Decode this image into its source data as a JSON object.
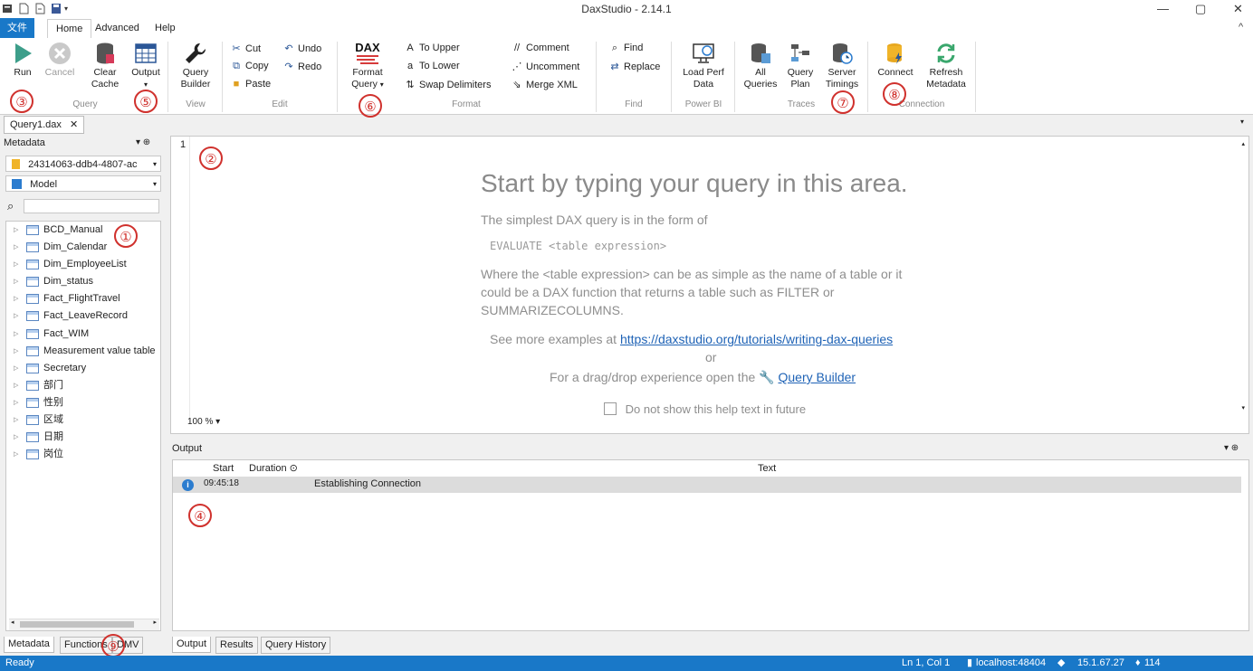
{
  "window": {
    "title": "DaxStudio - 2.14.1",
    "minimize_glyph": "—",
    "maximize_glyph": "▢",
    "close_glyph": "✕",
    "ribbon_collapse_glyph": "^"
  },
  "tabs": [
    {
      "label": "文件"
    },
    {
      "label": "Home"
    },
    {
      "label": "Advanced"
    },
    {
      "label": "Help"
    }
  ],
  "ribbon": {
    "query": {
      "run": "Run",
      "cancel": "Cancel",
      "clear_cache_1": "Clear",
      "clear_cache_2": "Cache",
      "output": "Output",
      "label": "Query"
    },
    "view": {
      "qb_1": "Query",
      "qb_2": "Builder",
      "label": "View"
    },
    "edit": {
      "cut": "Cut",
      "copy": "Copy",
      "paste": "Paste",
      "undo": "Undo",
      "redo": "Redo",
      "label": "Edit"
    },
    "format": {
      "dax_badge": "DAX",
      "fq_1": "Format",
      "fq_2": "Query",
      "to_upper": "To Upper",
      "to_lower": "To Lower",
      "swap": "Swap Delimiters",
      "comment": "Comment",
      "uncomment": "Uncomment",
      "merge": "Merge XML",
      "label": "Format"
    },
    "find": {
      "find": "Find",
      "replace": "Replace",
      "label": "Find"
    },
    "powerbi": {
      "lp_1": "Load Perf",
      "lp_2": "Data",
      "label": "Power BI"
    },
    "traces": {
      "aq_1": "All",
      "aq_2": "Queries",
      "qp_1": "Query",
      "qp_2": "Plan",
      "st_1": "Server",
      "st_2": "Timings",
      "label": "Traces"
    },
    "connection": {
      "connect": "Connect",
      "rm_1": "Refresh",
      "rm_2": "Metadata",
      "label": "Connection"
    }
  },
  "annotations": [
    "①",
    "②",
    "③",
    "④",
    "⑤",
    "⑥",
    "⑦",
    "⑧",
    "⑨"
  ],
  "doc_tab": {
    "label": "Query1.dax",
    "close": "✕"
  },
  "metadata": {
    "title": "Metadata",
    "pin": "▾ ⊕",
    "database": "24314063-ddb4-4807-ac",
    "model": "Model",
    "search_placeholder": "",
    "tables": [
      "BCD_Manual",
      "Dim_Calendar",
      "Dim_EmployeeList",
      "Dim_status",
      "Fact_FlightTravel",
      "Fact_LeaveRecord",
      "Fact_WIM",
      "Measurement value table",
      "Secretary",
      "部门",
      "性别",
      "区域",
      "日期",
      "岗位"
    ],
    "bottom_tabs": [
      "Metadata",
      "Functions",
      "DMV"
    ]
  },
  "editor": {
    "line_number": "1",
    "heading": "Start by typing your query in this area.",
    "simplest": "The simplest DAX query is in the form of",
    "evaluate": "EVALUATE <table expression>",
    "where_1": "Where the <table expression> can be as simple as the name of a table or it",
    "where_2": "could be a DAX function that returns a table such as FILTER or",
    "where_3": "SUMMARIZECOLUMNS.",
    "see_more": "See more examples at",
    "link": "https://daxstudio.org/tutorials/writing-dax-queries",
    "or": "or",
    "drag_drop": "For a drag/drop experience open the",
    "qb_link": "Query Builder",
    "checkbox_label": "Do not show this help text in future",
    "zoom": "100 % ▾"
  },
  "output": {
    "title": "Output",
    "columns": [
      "Start",
      "Duration ⊙",
      "Text"
    ],
    "rows": [
      {
        "start": "09:45:18",
        "text": "Establishing Connection"
      }
    ],
    "bottom_tabs": [
      "Output",
      "Results",
      "Query History"
    ]
  },
  "status": {
    "ready": "Ready",
    "position": "Ln 1, Col 1",
    "server": "localhost:48404",
    "version": "15.1.67.27",
    "count": "114"
  },
  "colors": {
    "accent": "#1978c8",
    "annotation": "#d0312d"
  }
}
